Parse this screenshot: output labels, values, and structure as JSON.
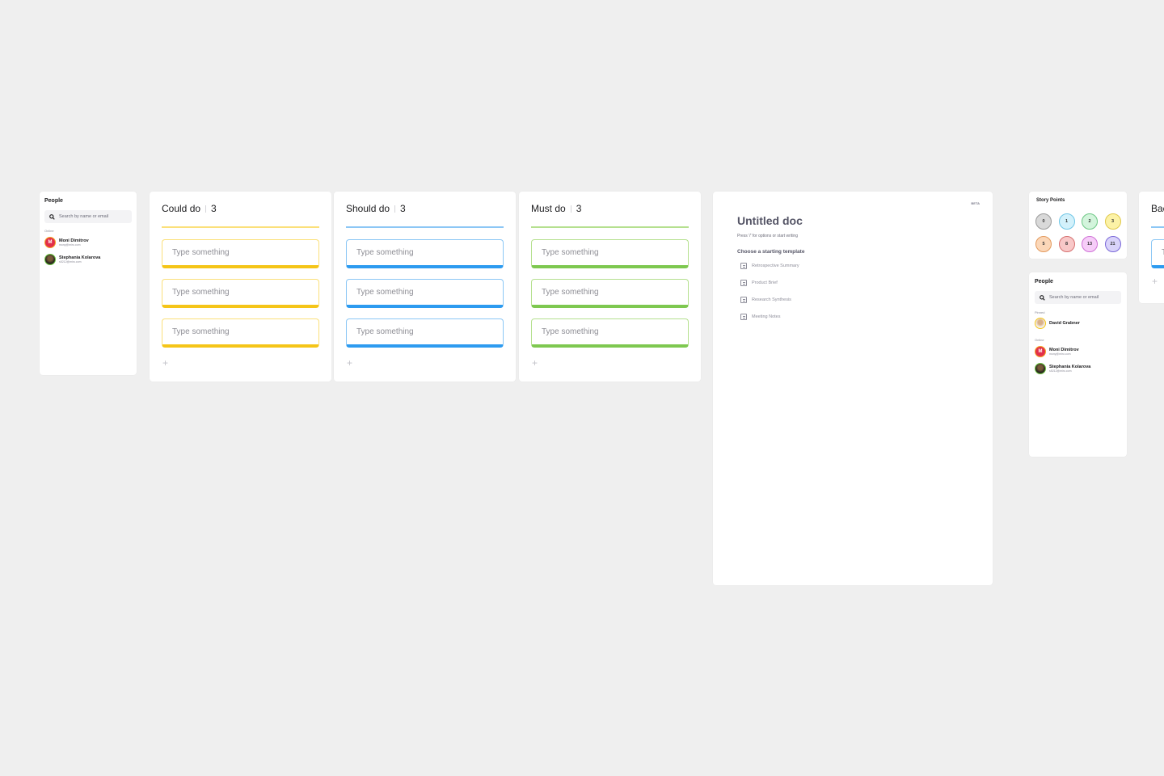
{
  "people_panel_left": {
    "title": "People",
    "search_placeholder": "Search by name or email",
    "online_label": "Online",
    "people": [
      {
        "initial": "M",
        "name": "Moni Dimitrov",
        "email": "mony@miro.com"
      },
      {
        "initial": "",
        "name": "Stephania Kolarova",
        "email": "s5212@miro.com"
      }
    ]
  },
  "columns": [
    {
      "title": "Could do",
      "count": "3",
      "color": "#f5c518",
      "light": "#fbe07a",
      "stickies": [
        "Type something",
        "Type something",
        "Type something"
      ],
      "add": "+"
    },
    {
      "title": "Should do",
      "count": "3",
      "color": "#2d9bf0",
      "light": "#8cc7f5",
      "stickies": [
        "Type something",
        "Type something",
        "Type something"
      ],
      "add": "+"
    },
    {
      "title": "Must do",
      "count": "3",
      "color": "#7ec850",
      "light": "#b5e08f",
      "stickies": [
        "Type something",
        "Type something",
        "Type something"
      ],
      "add": "+"
    }
  ],
  "doc": {
    "badge": "BETA",
    "title": "Untitled doc",
    "hint": "Press '/' for options or start writing",
    "templates_label": "Choose a starting template",
    "templates": [
      "Retrospective Summary",
      "Product Brief",
      "Research Synthesis",
      "Meeting Notes"
    ]
  },
  "story_points": {
    "title": "Story Points",
    "values": [
      {
        "label": "0",
        "bg": "#d9d9d9",
        "border": "#9a9a9a"
      },
      {
        "label": "1",
        "bg": "#d3f1fb",
        "border": "#6fc6e6"
      },
      {
        "label": "2",
        "bg": "#d3f4dc",
        "border": "#6cc784"
      },
      {
        "label": "3",
        "bg": "#fcf2a6",
        "border": "#e0c84a"
      },
      {
        "label": "5",
        "bg": "#fbd7b8",
        "border": "#e39a5d"
      },
      {
        "label": "8",
        "bg": "#f8c8c8",
        "border": "#d67070"
      },
      {
        "label": "13",
        "bg": "#f6cdf8",
        "border": "#cf72d6"
      },
      {
        "label": "21",
        "bg": "#d9d3fa",
        "border": "#7a68d8"
      }
    ]
  },
  "people_panel_right": {
    "title": "People",
    "search_placeholder": "Search by name or email",
    "pinned_label": "Pinned",
    "pinned": [
      {
        "name": "David Grabner"
      }
    ],
    "online_label": "Online",
    "people": [
      {
        "initial": "M",
        "name": "Moni Dimitrov",
        "email": "mony@miro.com"
      },
      {
        "initial": "",
        "name": "Stephania Kolarova",
        "email": "s5212@miro.com"
      }
    ]
  },
  "partial_column": {
    "title": "Backlog",
    "sticky": "Type something",
    "add": "+",
    "color": "#2d9bf0",
    "light": "#8cc7f5"
  }
}
